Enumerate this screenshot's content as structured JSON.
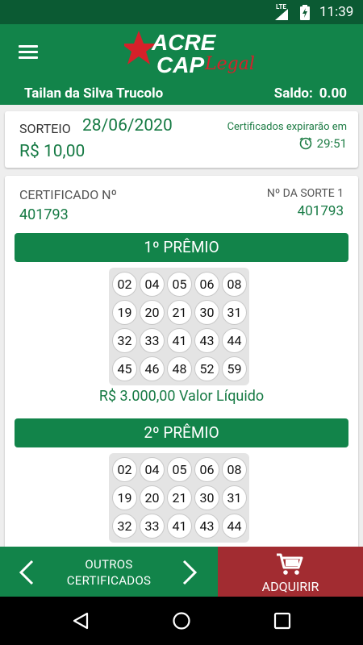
{
  "status_bar": {
    "network": "LTE",
    "time": "11:39"
  },
  "app": {
    "logo_text_1": "ACRE",
    "logo_text_2": "CAP",
    "logo_text_3": "Legal",
    "user_name": "Tailan da Silva Trucolo",
    "balance_label": "Saldo:",
    "balance_value": "0.00"
  },
  "draw": {
    "label": "SORTEIO",
    "date": "28/06/2020",
    "price": "R$ 10,00",
    "expire_text": "Certificados expirarão em",
    "timer": "29:51"
  },
  "certificate": {
    "label": "CERTIFICADO Nº",
    "number": "401793",
    "luck_label": "Nº DA SORTE 1",
    "luck_number": "401793"
  },
  "prizes": [
    {
      "title": "1º PRÊMIO",
      "numbers": [
        "02",
        "04",
        "05",
        "06",
        "08",
        "19",
        "20",
        "21",
        "30",
        "31",
        "32",
        "33",
        "41",
        "43",
        "44",
        "45",
        "46",
        "48",
        "52",
        "59"
      ],
      "value": "R$ 3.000,00 Valor Líquido"
    },
    {
      "title": "2º PRÊMIO",
      "numbers": [
        "02",
        "04",
        "05",
        "06",
        "08",
        "19",
        "20",
        "21",
        "30",
        "31",
        "32",
        "33",
        "41",
        "43",
        "44"
      ]
    }
  ],
  "bottom_nav": {
    "other_line1": "OUTROS",
    "other_line2": "CERTIFICADOS",
    "buy_label": "ADQUIRIR"
  },
  "colors": {
    "primary_green": "#12844a",
    "dark_green": "#0b5a33",
    "text_green": "#167a44",
    "buy_red": "#a22c31"
  },
  "icons": [
    "menu-icon",
    "star-icon",
    "clock-icon",
    "chevron-left-icon",
    "chevron-right-icon",
    "cart-icon",
    "back-icon",
    "home-icon",
    "recents-icon"
  ]
}
